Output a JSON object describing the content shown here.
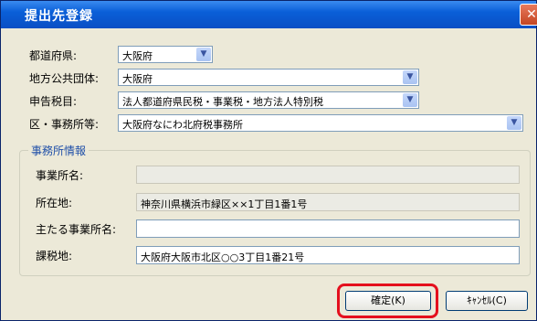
{
  "window": {
    "title": "提出先登録",
    "close_glyph": "✕"
  },
  "form": {
    "prefecture_label": "都道府県:",
    "prefecture_value": "大阪府",
    "local_gov_label": "地方公共団体:",
    "local_gov_value": "大阪府",
    "tax_item_label": "申告税目:",
    "tax_item_value": "法人都道府県民税・事業税・地方法人特別税",
    "office_label": "区・事務所等:",
    "office_value": "大阪府なにわ北府税事務所",
    "dropdown_glyph": "▼"
  },
  "office_info": {
    "group_title": "事務所情報",
    "business_name_label": "事業所名:",
    "business_name_value": "",
    "address_label": "所在地:",
    "address_value": "神奈川県横浜市緑区××1丁目1番1号",
    "main_office_label": "主たる事業所名:",
    "main_office_value": "",
    "tax_location_label": "課税地:",
    "tax_location_value": "大阪府大阪市北区○○3丁目1番21号"
  },
  "buttons": {
    "ok": "確定(K)",
    "cancel": "ｷｬﾝｾﾙ(C)"
  },
  "colors": {
    "title_bar": "#0a4fc4",
    "highlight": "#e4101d",
    "group_title": "#1f4fa8"
  }
}
